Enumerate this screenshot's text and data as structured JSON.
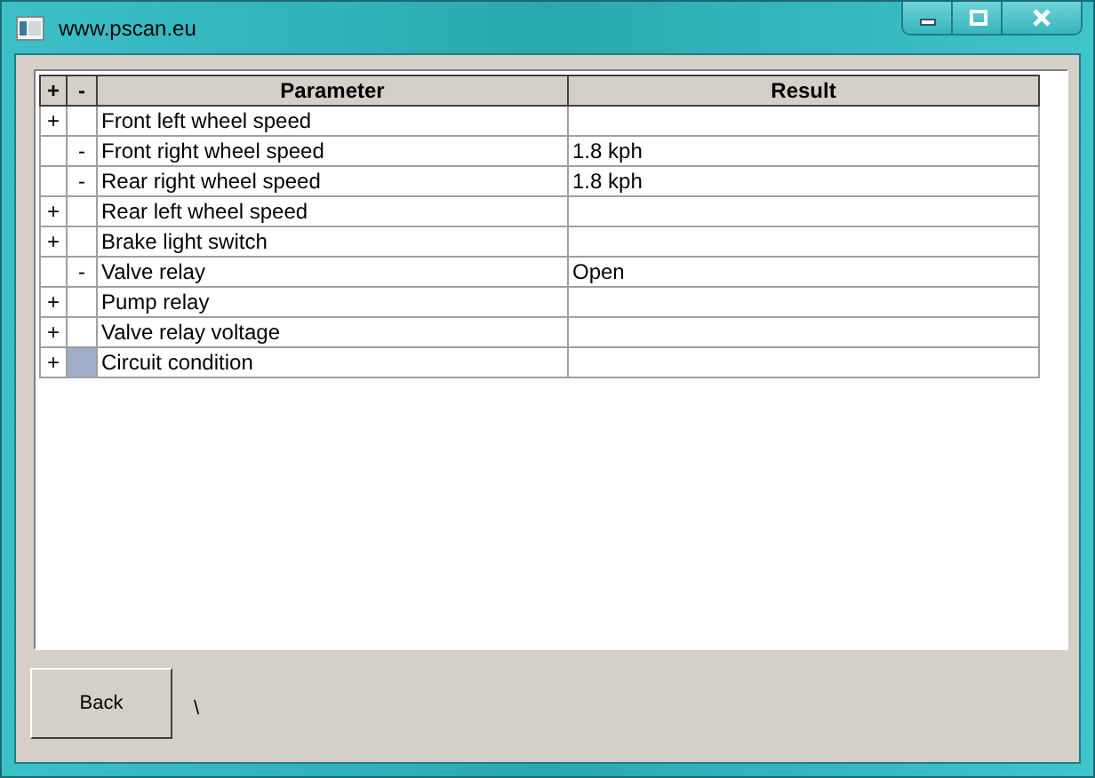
{
  "window": {
    "title": "www.pscan.eu"
  },
  "table": {
    "columns": [
      "+",
      "-",
      "Parameter",
      "Result"
    ],
    "rows": [
      {
        "expand": "+",
        "collapse": "",
        "parameter": "Front left wheel speed",
        "result": "",
        "selected": false
      },
      {
        "expand": "",
        "collapse": "-",
        "parameter": "Front right wheel speed",
        "result": "1.8 kph",
        "selected": false
      },
      {
        "expand": "",
        "collapse": "-",
        "parameter": "Rear right wheel speed",
        "result": "1.8 kph",
        "selected": false
      },
      {
        "expand": "+",
        "collapse": "",
        "parameter": "Rear left wheel speed",
        "result": "",
        "selected": false
      },
      {
        "expand": "+",
        "collapse": "",
        "parameter": "Brake light switch",
        "result": "",
        "selected": false
      },
      {
        "expand": "",
        "collapse": "-",
        "parameter": "Valve relay",
        "result": "Open",
        "selected": false
      },
      {
        "expand": "+",
        "collapse": "",
        "parameter": "Pump relay",
        "result": "",
        "selected": false
      },
      {
        "expand": "+",
        "collapse": "",
        "parameter": "Valve relay voltage",
        "result": "",
        "selected": false
      },
      {
        "expand": "+",
        "collapse": "",
        "parameter": "Circuit condition",
        "result": "",
        "selected": true
      }
    ]
  },
  "buttons": [
    "Back"
  ],
  "status": "\\"
}
